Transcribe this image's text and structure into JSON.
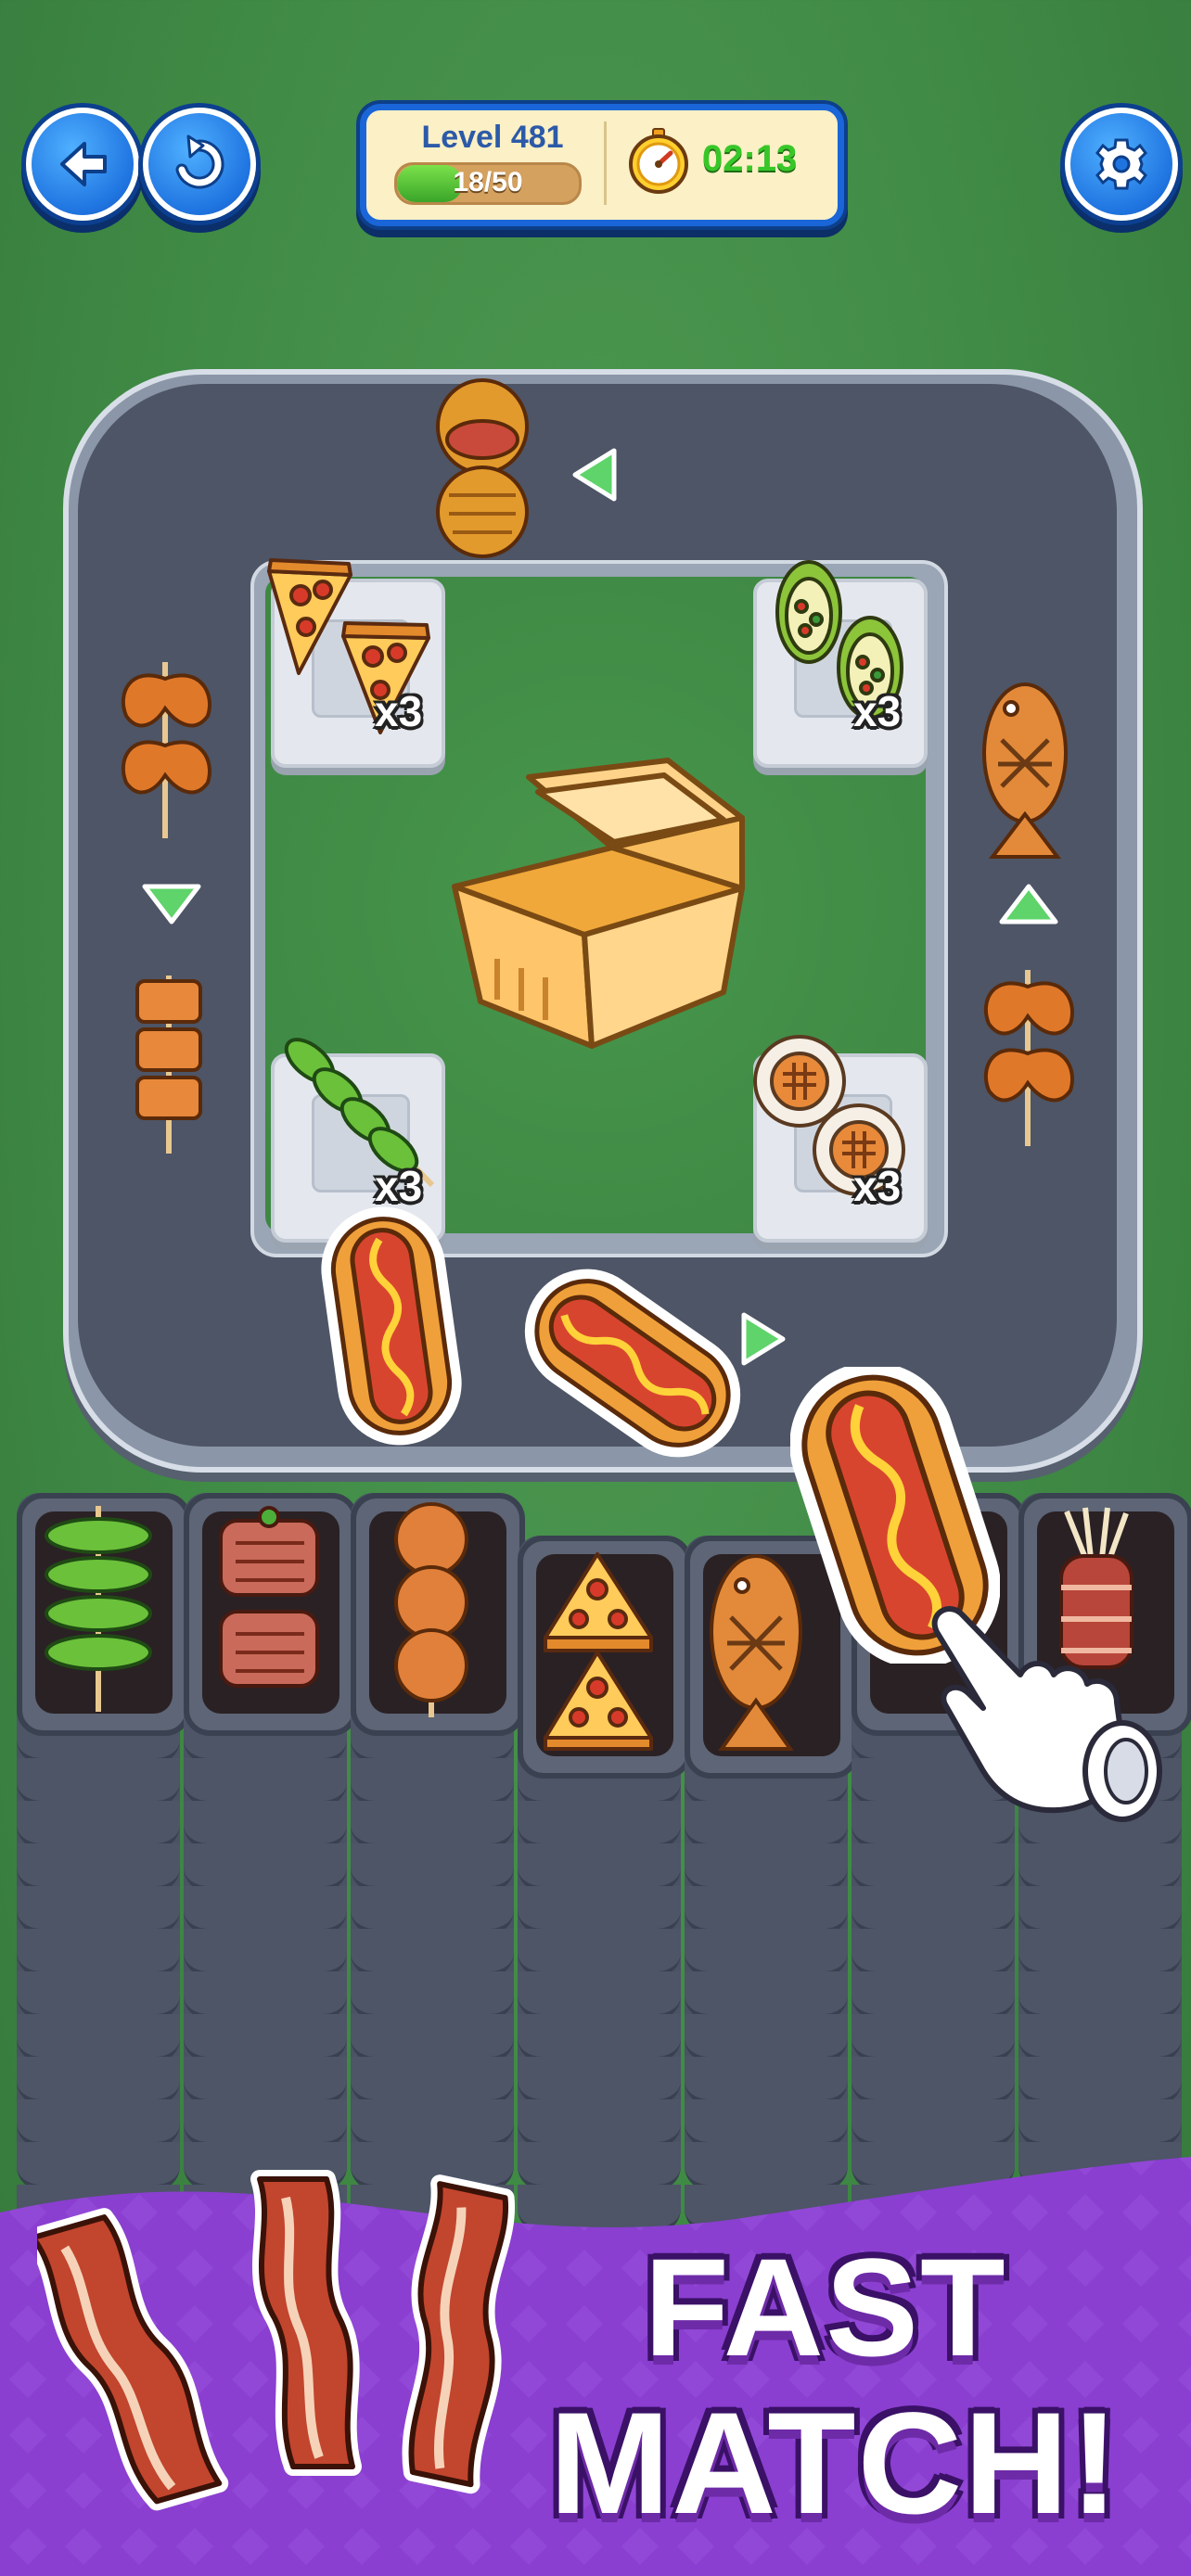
{
  "game": {
    "level_label": "Level 481",
    "progress_text": "18/50",
    "progress": {
      "current": 18,
      "total": 50
    },
    "timer": "02:13"
  },
  "toolbar": {
    "back_icon": "arrow-left-icon",
    "restart_icon": "restart-icon",
    "settings_icon": "gear-icon",
    "timer_icon": "stopwatch-icon"
  },
  "board": {
    "center_item": "takeout-box",
    "order_slots": [
      {
        "item": "pizza-slice",
        "count": "x3"
      },
      {
        "item": "stuffed-avocado",
        "count": "x3"
      },
      {
        "item": "okra-skewer",
        "count": "x3"
      },
      {
        "item": "grilled-scallop",
        "count": "x3"
      }
    ],
    "conveyor_items": [
      "baked-croissant-roll",
      "chicken-wing-skewer",
      "tofu-skewer",
      "grilled-fish",
      "chicken-wing-skewer",
      "hot-dog",
      "hot-dog"
    ],
    "selected_item": "hot-dog",
    "conveyor_direction_icons": [
      "triangle-left-icon",
      "triangle-down-icon",
      "triangle-up-icon",
      "triangle-right-icon"
    ]
  },
  "trays": [
    {
      "item": "okra-skewer"
    },
    {
      "item": "rib-skewer"
    },
    {
      "item": "meatball-skewer"
    },
    {
      "item": "pizza-slice"
    },
    {
      "item": "grilled-fish"
    },
    {
      "item": "empty"
    },
    {
      "item": "enoki-bacon-roll"
    }
  ],
  "banner": {
    "line1": "FAST",
    "line2": "MATCH!",
    "decoration": "bacon-strips"
  },
  "colors": {
    "table_green": "#3f8a45",
    "button_blue": "#1f74e0",
    "timer_green": "#38c728",
    "banner_purple": "#8a3fd0"
  }
}
